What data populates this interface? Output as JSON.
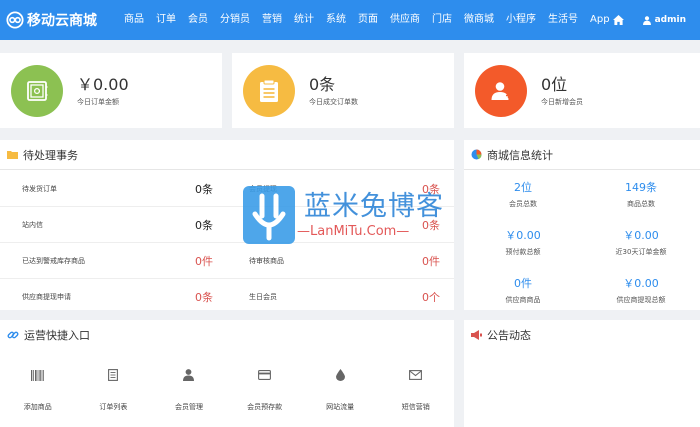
{
  "header": {
    "brand": "移动云商城",
    "nav": [
      "商品",
      "订单",
      "会员",
      "分销员",
      "营销",
      "统计",
      "系统",
      "页面",
      "供应商",
      "门店",
      "微商城",
      "小程序",
      "生活号",
      "App"
    ],
    "user": "admin"
  },
  "stats": [
    {
      "value": "￥0.00",
      "label": "今日订单金额",
      "color": "#8cc152",
      "icon": "safe-icon"
    },
    {
      "value": "0条",
      "label": "今日成交订单数",
      "color": "#f6bb42",
      "icon": "clipboard-icon"
    },
    {
      "value": "0位",
      "label": "今日新增会员",
      "color": "#f35a2a",
      "icon": "user-plus-icon"
    }
  ],
  "todo": {
    "title": "待处理事务",
    "rows": [
      [
        {
          "label": "待发货订单",
          "value": "0条",
          "red": false
        },
        {
          "label": "会员提现",
          "value": "0条",
          "red": true
        }
      ],
      [
        {
          "label": "站内信",
          "value": "0条",
          "red": false
        },
        {
          "label": "",
          "value": "0条",
          "red": true
        }
      ],
      [
        {
          "label": "已达到警戒库存商品",
          "value": "0件",
          "red": true
        },
        {
          "label": "待审核商品",
          "value": "0件",
          "red": true
        }
      ],
      [
        {
          "label": "供应商提现申请",
          "value": "0条",
          "red": true
        },
        {
          "label": "生日会员",
          "value": "0个",
          "red": true
        }
      ]
    ]
  },
  "store": {
    "title": "商城信息统计",
    "items": [
      {
        "value": "2位",
        "label": "会员总数"
      },
      {
        "value": "149条",
        "label": "商品总数"
      },
      {
        "value": "￥0.00",
        "label": "预付款总额"
      },
      {
        "value": "￥0.00",
        "label": "近30天订单金额"
      },
      {
        "value": "0件",
        "label": "供应商商品"
      },
      {
        "value": "￥0.00",
        "label": "供应商提现总额"
      }
    ]
  },
  "quick": {
    "title": "运营快捷入口",
    "items": [
      {
        "label": "添加商品",
        "icon": "barcode-icon"
      },
      {
        "label": "订单列表",
        "icon": "list-doc-icon"
      },
      {
        "label": "会员管理",
        "icon": "user-icon"
      },
      {
        "label": "会员预存款",
        "icon": "card-icon"
      },
      {
        "label": "网站流量",
        "icon": "drop-icon"
      },
      {
        "label": "短信营销",
        "icon": "mail-icon"
      }
    ]
  },
  "notice": {
    "title": "公告动态"
  },
  "watermark": {
    "cn": "蓝米兔博客",
    "en": "—LanMiTu.Com—"
  },
  "colors": {
    "primary": "#2e8ded",
    "red": "#d9534f"
  }
}
